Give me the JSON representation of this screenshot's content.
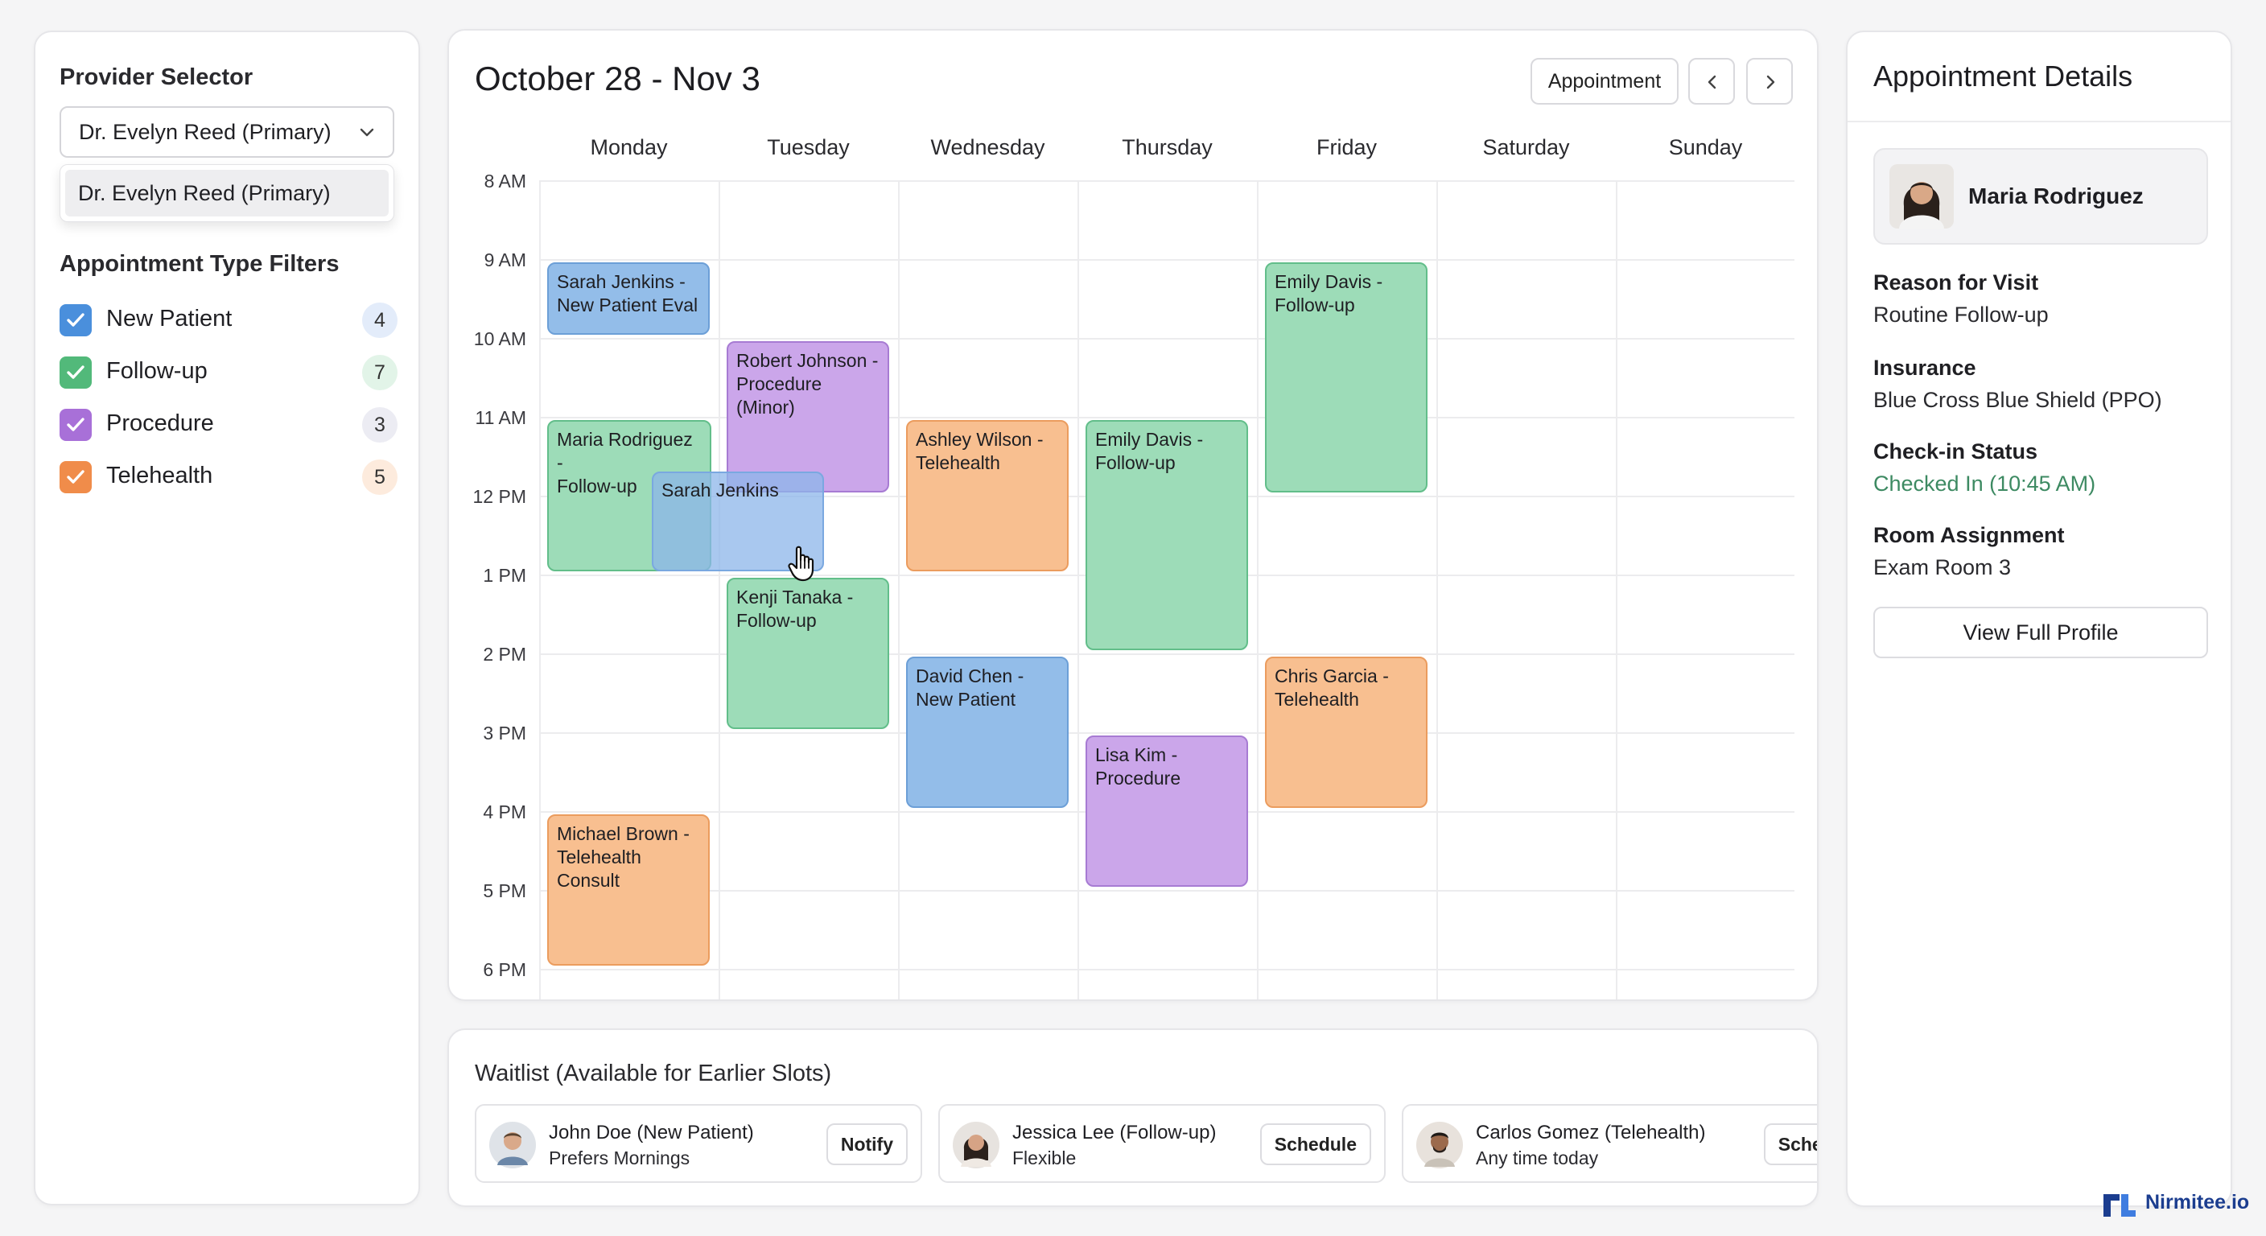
{
  "colors": {
    "new_patient": "#4a8fdc",
    "follow_up": "#52b97a",
    "procedure": "#a870d8",
    "telehealth": "#f08c4a",
    "checked_in": "#3d8a62",
    "brand": "#1b3d8f"
  },
  "sidebar": {
    "provider_heading": "Provider Selector",
    "provider_selected": "Dr. Evelyn Reed (Primary)",
    "provider_options": [
      "Dr. Evelyn Reed (Primary)"
    ],
    "filters_heading": "Appointment Type Filters",
    "filters": [
      {
        "label": "New Patient",
        "count": "4",
        "checked": true
      },
      {
        "label": "Follow-up",
        "count": "7",
        "checked": true
      },
      {
        "label": "Procedure",
        "count": "3",
        "checked": true
      },
      {
        "label": "Telehealth",
        "count": "5",
        "checked": true
      }
    ]
  },
  "calendar": {
    "title": "October 28 - Nov 3",
    "appointment_button": "Appointment",
    "days": [
      "Monday",
      "Tuesday",
      "Wednesday",
      "Thursday",
      "Friday",
      "Saturday",
      "Sunday"
    ],
    "hours": [
      "8 AM",
      "9 AM",
      "10 AM",
      "11 AM",
      "12 PM",
      "1 PM",
      "2 PM",
      "3 PM",
      "4 PM",
      "5 PM",
      "6 PM"
    ],
    "appointments": [
      {
        "line1": "Sarah Jenkins -",
        "line2": "New Patient Eval"
      },
      {
        "line1": "Maria Rodriguez -",
        "line2": "Follow-up"
      },
      {
        "line1": "Michael Brown -",
        "line2": "Telehealth Consult"
      },
      {
        "line1": "Robert Johnson -",
        "line2": "Procedure (Minor)"
      },
      {
        "line1": "Kenji Tanaka -",
        "line2": "Follow-up"
      },
      {
        "line1": "Ashley Wilson -",
        "line2": "Telehealth"
      },
      {
        "line1": "David Chen -",
        "line2": "New Patient"
      },
      {
        "line1": "Emily Davis -",
        "line2": "Follow-up"
      },
      {
        "line1": "Lisa Kim -",
        "line2": "Procedure"
      },
      {
        "line1": "Emily Davis -",
        "line2": "Follow-up"
      },
      {
        "line1": "Chris Garcia -",
        "line2": "Telehealth"
      }
    ],
    "drag_ghost": "Sarah Jenkins"
  },
  "waitlist": {
    "title": "Waitlist (Available for Earlier Slots)",
    "items": [
      {
        "name": "John Doe (New Patient)",
        "sub": "Prefers Mornings",
        "action": "Notify"
      },
      {
        "name": "Jessica Lee (Follow-up)",
        "sub": "Flexible",
        "action": "Schedule"
      },
      {
        "name": "Carlos Gomez (Telehealth)",
        "sub": "Any time today",
        "action": "Schedule"
      }
    ]
  },
  "details": {
    "title": "Appointment Details",
    "patient_name": "Maria Rodriguez",
    "reason_label": "Reason for Visit",
    "reason_value": "Routine Follow-up",
    "insurance_label": "Insurance",
    "insurance_value": "Blue Cross Blue Shield (PPO)",
    "checkin_label": "Check-in Status",
    "checkin_value": "Checked In (10:45 AM)",
    "room_label": "Room Assignment",
    "room_value": "Exam Room 3",
    "profile_button": "View Full Profile"
  },
  "brand": {
    "name": "Nirmitee.io"
  }
}
